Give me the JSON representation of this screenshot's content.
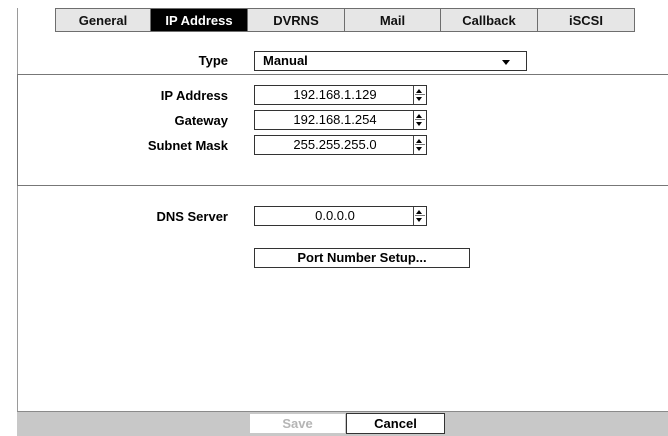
{
  "tabs": [
    {
      "label": "General",
      "active": false
    },
    {
      "label": "IP Address",
      "active": true
    },
    {
      "label": "DVRNS",
      "active": false
    },
    {
      "label": "Mail",
      "active": false
    },
    {
      "label": "Callback",
      "active": false
    },
    {
      "label": "iSCSI",
      "active": false
    }
  ],
  "type": {
    "label": "Type",
    "value": "Manual",
    "icon": "chevron-down-icon"
  },
  "ip_address": {
    "label": "IP Address",
    "value": "192.168.1.129"
  },
  "gateway": {
    "label": "Gateway",
    "value": "192.168.1.254"
  },
  "subnet_mask": {
    "label": "Subnet Mask",
    "value": "255.255.255.0"
  },
  "dns_server": {
    "label": "DNS Server",
    "value": "0.0.0.0"
  },
  "port_setup_label": "Port Number Setup...",
  "footer": {
    "save_label": "Save",
    "save_enabled": false,
    "cancel_label": "Cancel"
  },
  "colors": {
    "active_tab_bg": "#000000",
    "active_tab_fg": "#ffffff",
    "footer_bg": "#c8c8c8",
    "disabled_text": "#b5b5b5"
  }
}
